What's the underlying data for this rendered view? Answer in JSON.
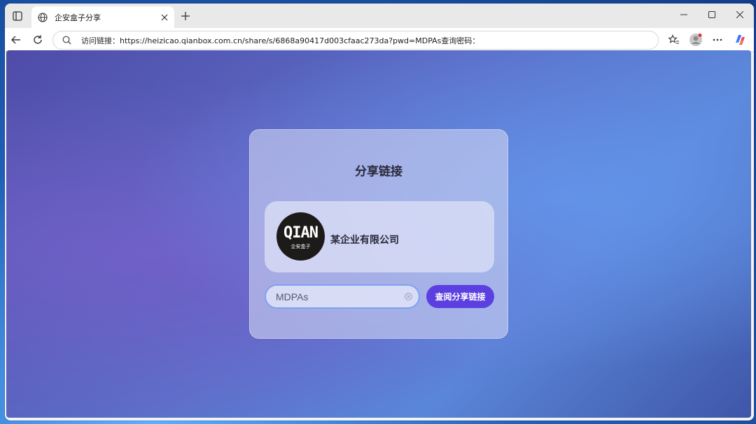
{
  "tab": {
    "title": "企安盒子分享"
  },
  "toolbar": {
    "address": "访问链接：https://heizicao.qianbox.com.cn/share/s/6868a90417d003cfaac273da?pwd=MDPAs查询密码："
  },
  "card": {
    "title": "分享链接",
    "logo_mark": "QIAN",
    "logo_sub": "企安盒子",
    "company_name": "某企业有限公司",
    "password_value": "MDPAs",
    "query_button_label": "查阅分享链接"
  },
  "colors": {
    "accent_button": "#5b3fe0",
    "input_border": "#7da2f0"
  },
  "icons": [
    "tab-actions-icon",
    "globe-icon",
    "close-icon",
    "plus-icon",
    "minimize-icon",
    "maximize-icon",
    "window-close-icon",
    "back-arrow-icon",
    "refresh-icon",
    "search-icon",
    "favorites-star-icon",
    "profile-avatar-icon",
    "more-options-icon",
    "copilot-icon",
    "clear-input-icon"
  ]
}
